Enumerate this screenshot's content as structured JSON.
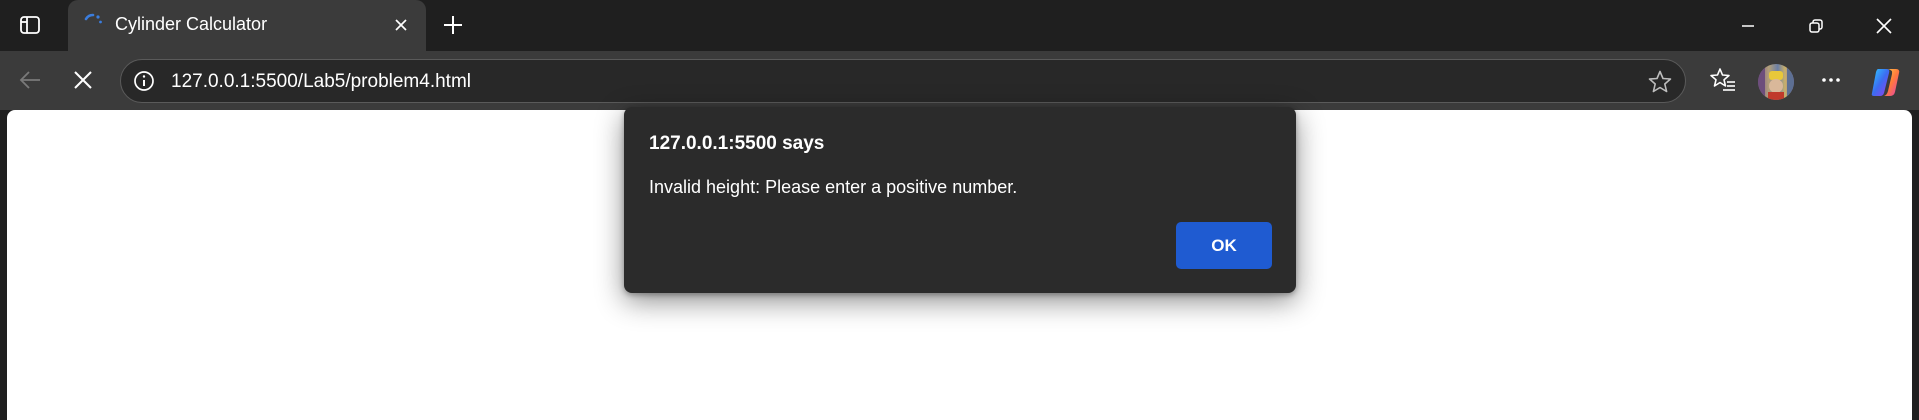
{
  "window": {
    "tab": {
      "title": "Cylinder Calculator",
      "loading": true,
      "spinner_color": "#3b7ddd"
    },
    "buttons": [
      "tab-actions",
      "new-tab",
      "minimize",
      "restore",
      "close"
    ]
  },
  "toolbar": {
    "url": "127.0.0.1:5500/Lab5/problem4.html",
    "icons": [
      "back-arrow-icon",
      "stop-loading-icon",
      "info-icon",
      "favorite-star-icon",
      "favorites-icon",
      "profile-avatar",
      "more-icon",
      "copilot-icon"
    ]
  },
  "dialog": {
    "origin": "127.0.0.1:5500 says",
    "message": "Invalid height: Please enter a positive number.",
    "ok_label": "OK",
    "ok_color": "#1f5bd1"
  },
  "colors": {
    "titlebar": "#1f1f1f",
    "toolbar": "#3b3b3b",
    "omnibox": "#282828",
    "dialog": "#2b2b2b",
    "page": "#ffffff"
  }
}
